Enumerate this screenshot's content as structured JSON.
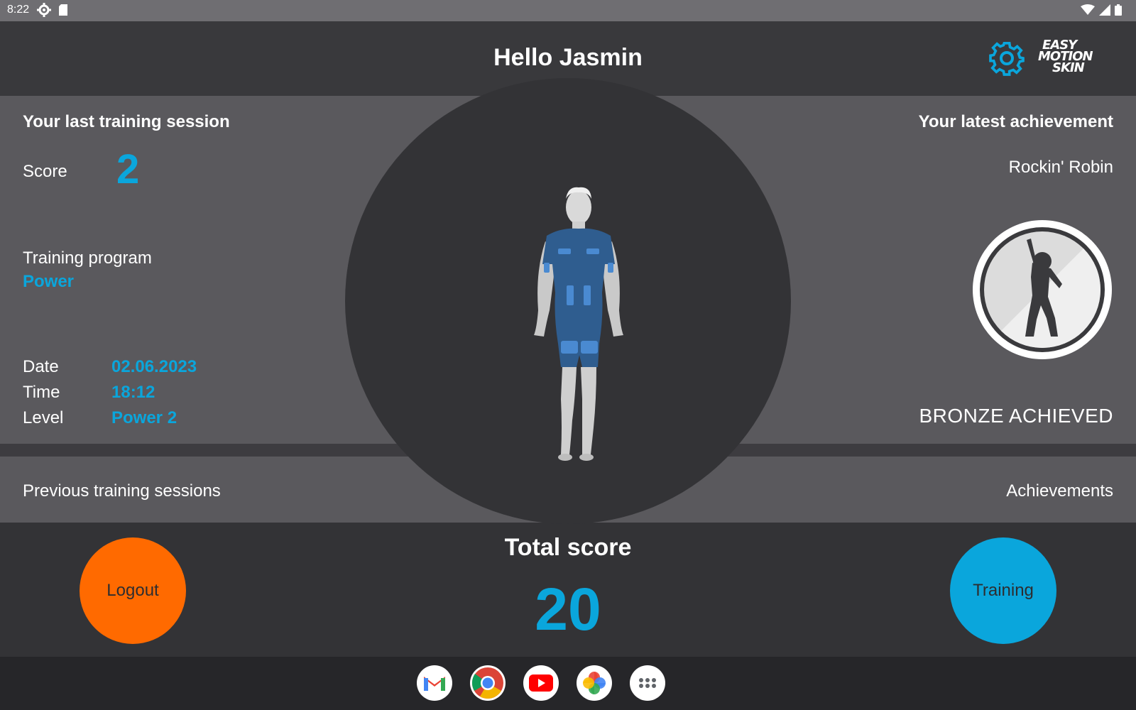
{
  "status_bar": {
    "time": "8:22",
    "icons": [
      "settings-icon",
      "sd-card-icon",
      "wifi-icon",
      "signal-icon",
      "battery-icon"
    ]
  },
  "header": {
    "title": "Hello Jasmin",
    "brand": [
      "EASY",
      "MOTION",
      "SKIN"
    ]
  },
  "last_session": {
    "title": "Your last training session",
    "score_label": "Score",
    "score_value": "2",
    "program_label": "Training program",
    "program_value": "Power",
    "date_label": "Date",
    "date_value": "02.06.2023",
    "time_label": "Time",
    "time_value": "18:12",
    "level_label": "Level",
    "level_value": "Power 2"
  },
  "achievement": {
    "title": "Your latest achievement",
    "name": "Rockin' Robin",
    "status": "BRONZE ACHIEVED"
  },
  "nav": {
    "previous_sessions": "Previous training sessions",
    "achievements": "Achievements"
  },
  "actions": {
    "logout": "Logout",
    "training": "Training"
  },
  "total": {
    "label": "Total score",
    "value": "20"
  },
  "colors": {
    "accent": "#0aa6dc",
    "logout": "#ff6a00",
    "panel": "#5a595d",
    "background": "#333336"
  },
  "dock": [
    "gmail-icon",
    "chrome-icon",
    "youtube-icon",
    "photos-icon",
    "app-drawer-icon"
  ]
}
